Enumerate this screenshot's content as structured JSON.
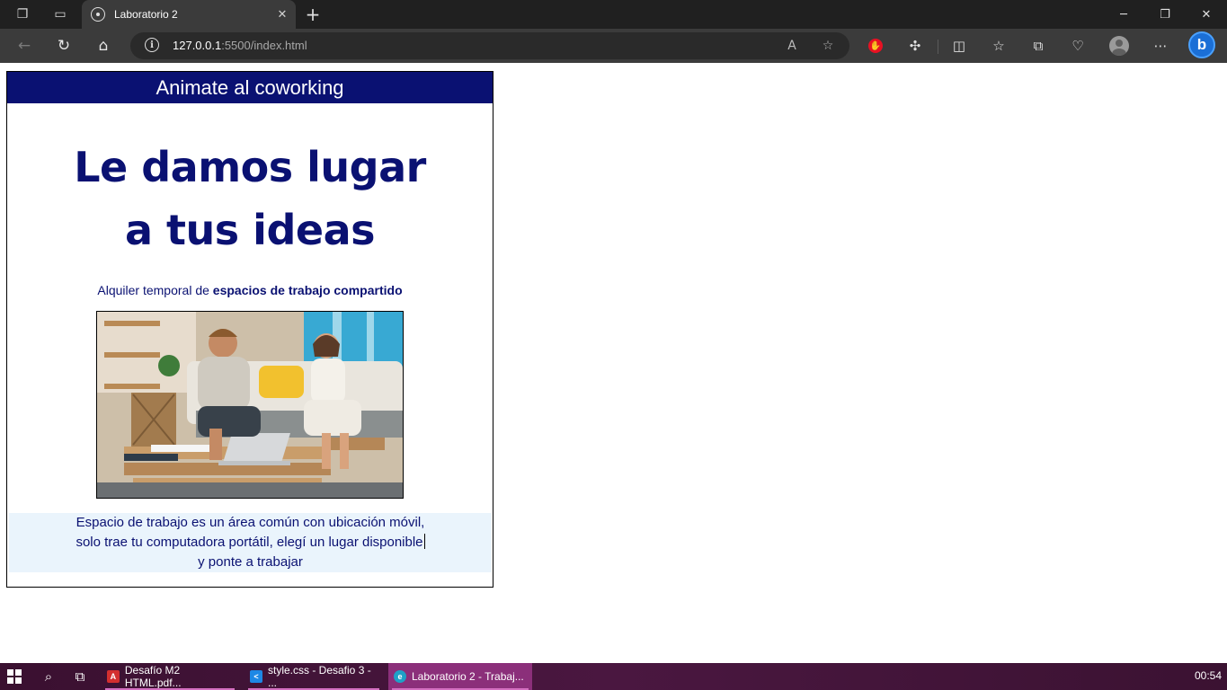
{
  "browser": {
    "tab_title": "Laboratorio 2",
    "url_host": "127.0.0.1",
    "url_rest": ":5500/index.html"
  },
  "page": {
    "header": "Animate al coworking",
    "hero_line1": "Le damos lugar",
    "hero_line2": "a tus ideas",
    "subtitle_prefix": "Alquiler temporal de ",
    "subtitle_bold": "espacios de trabajo compartido",
    "info_line1": "Espacio de trabajo es un área común con ubicación móvil,",
    "info_line2": "solo trae tu computadora portátil, elegí un lugar disponible",
    "info_line3": "y ponte a trabajar"
  },
  "taskbar": {
    "apps": [
      {
        "label": "Desafío M2 HTML.pdf..."
      },
      {
        "label": "style.css - Desafio 3 - ..."
      },
      {
        "label": "Laboratorio 2 - Trabaj..."
      }
    ],
    "clock": "00:54"
  },
  "colors": {
    "primary_navy": "#0a1172",
    "info_background": "#eaf4fc",
    "taskbar": "#3a1030"
  }
}
